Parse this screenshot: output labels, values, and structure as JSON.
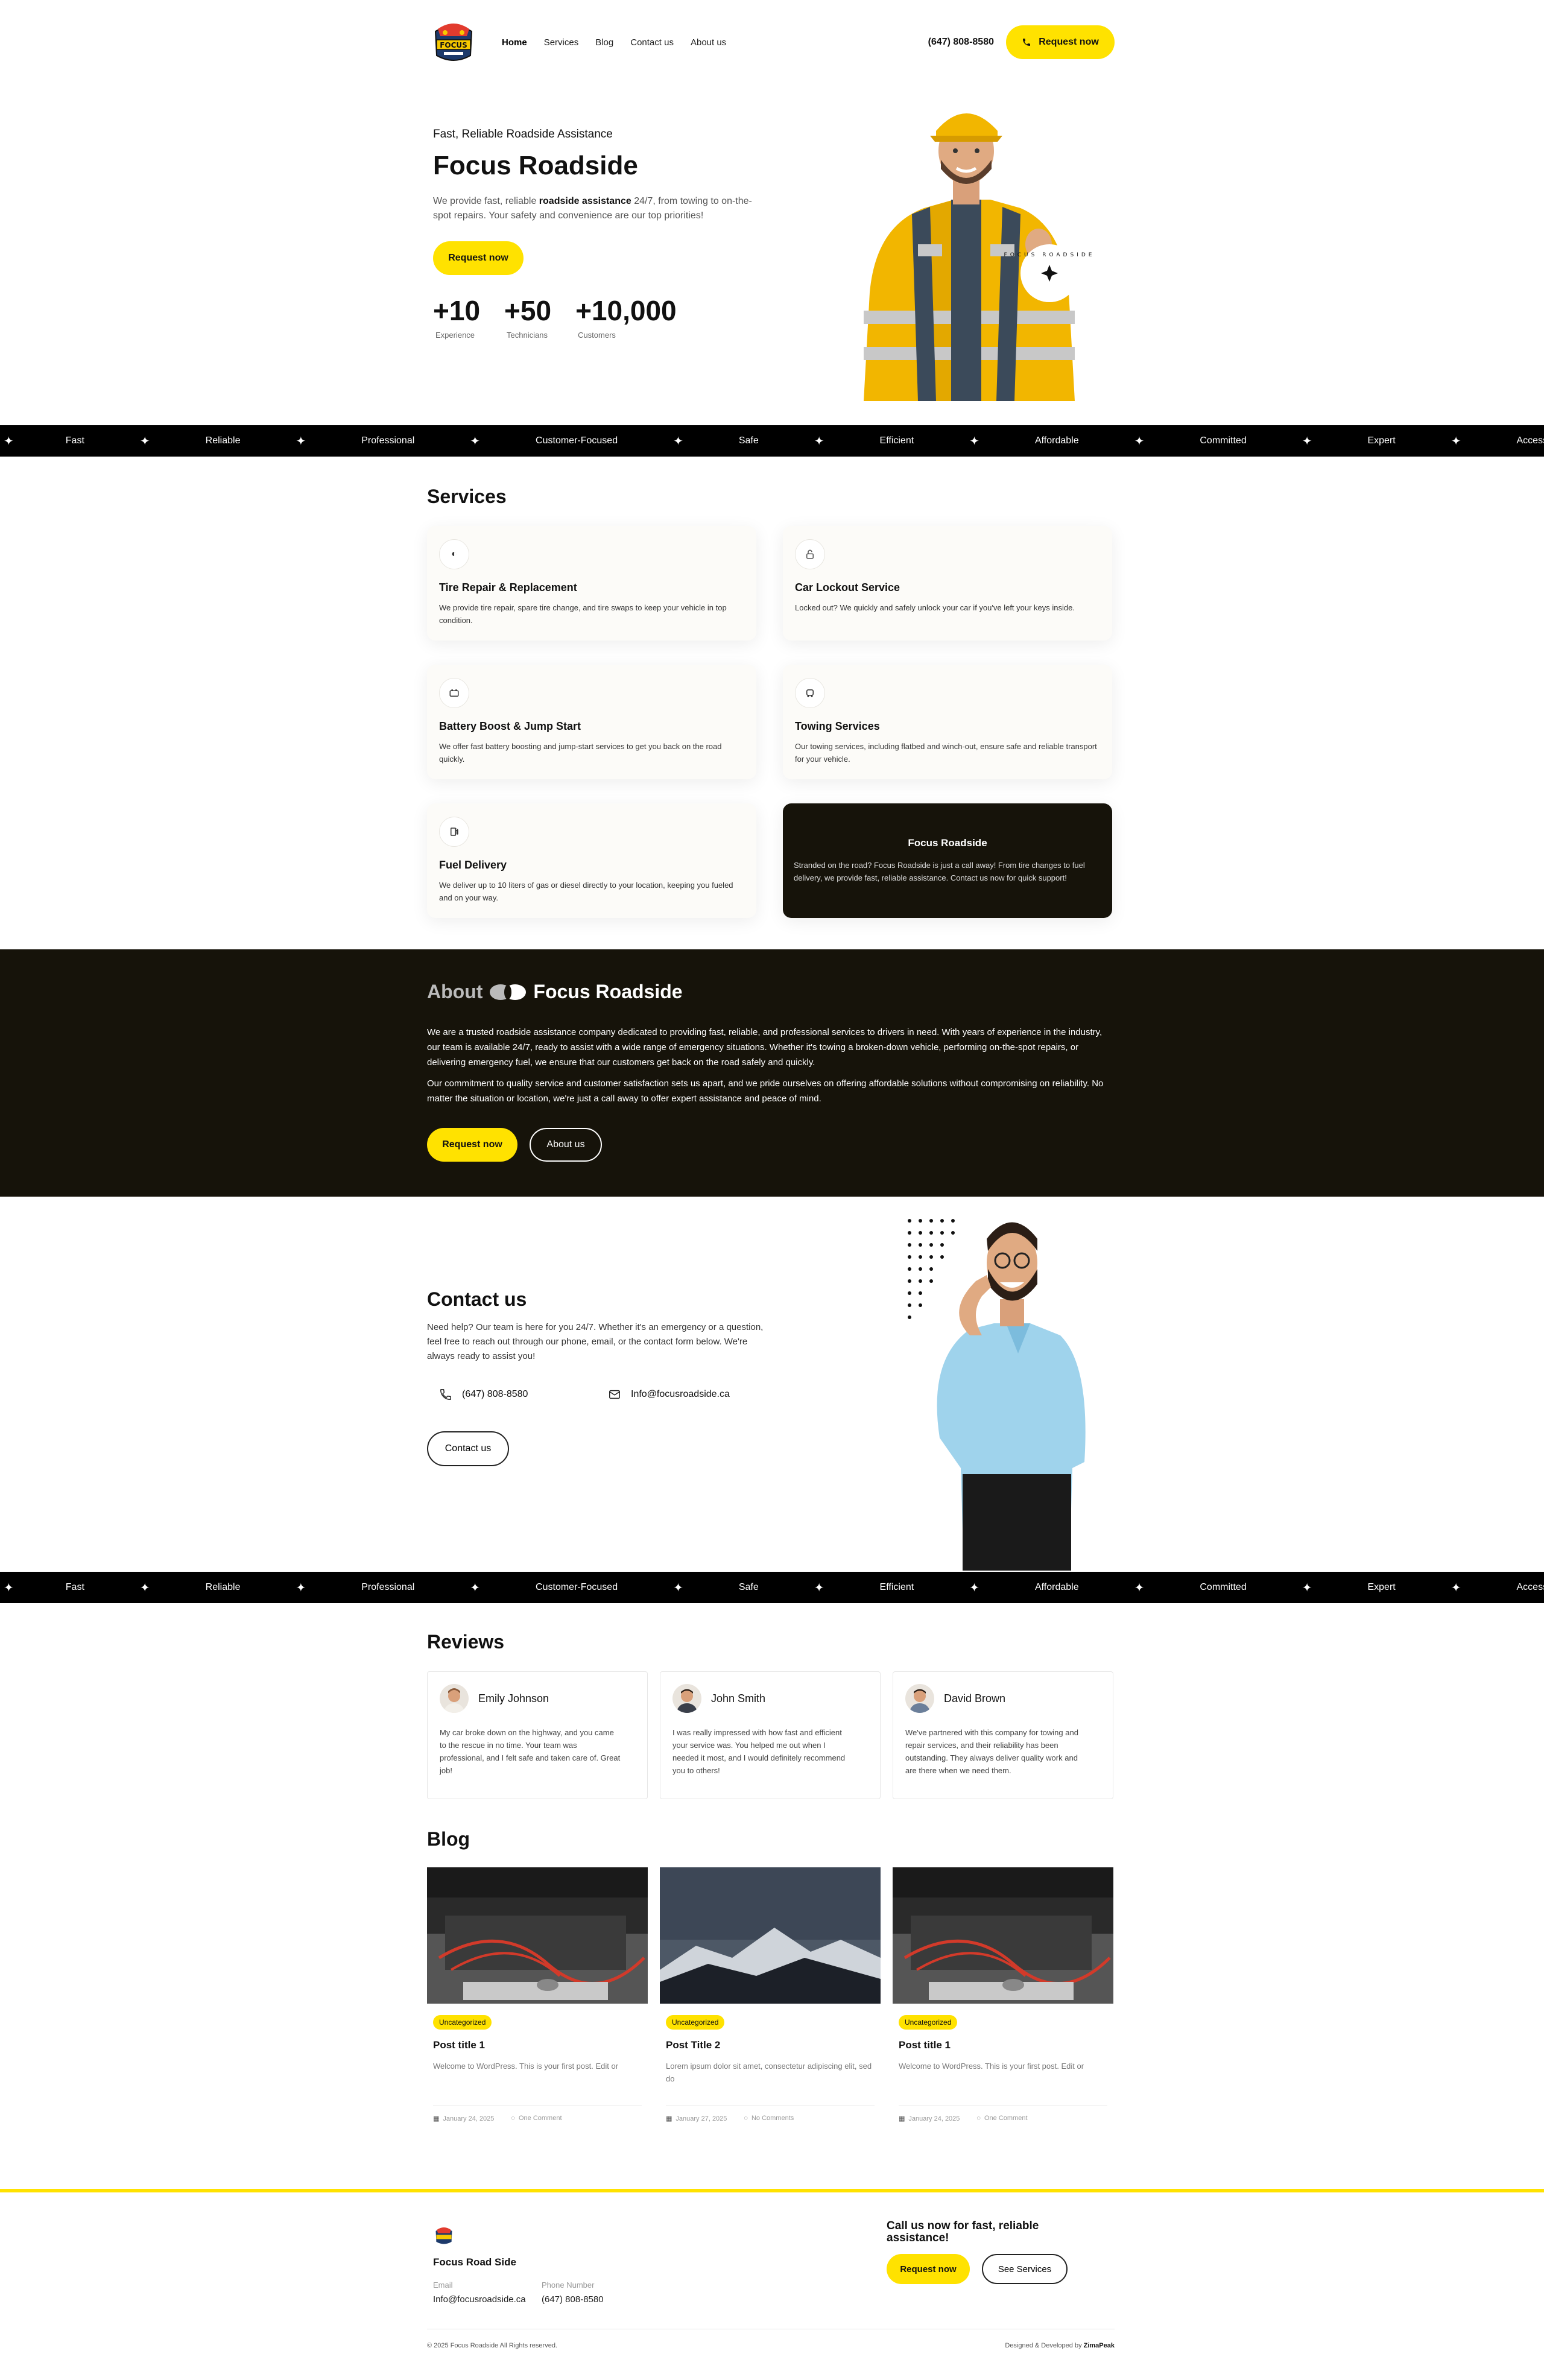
{
  "header": {
    "nav": [
      "Home",
      "Services",
      "Blog",
      "Contact us",
      "About us"
    ],
    "phone": "(647) 808-8580",
    "cta": "Request now"
  },
  "hero": {
    "tagline": "Fast, Reliable Roadside Assistance",
    "title": "Focus Roadside",
    "desc_before": "We provide fast, reliable ",
    "desc_bold": "roadside assistance",
    "desc_after": " 24/7, from towing to on-the-spot repairs. Your safety and convenience are our top priorities!",
    "cta": "Request now",
    "stats": [
      {
        "value": "+10",
        "label": "Experience"
      },
      {
        "value": "+50",
        "label": "Technicians"
      },
      {
        "value": "+10,000",
        "label": "Customers"
      }
    ],
    "badge_text": "FOCUS ROADSIDE"
  },
  "ticker": [
    "Fast",
    "Reliable",
    "Professional",
    "Customer-Focused",
    "Safe",
    "Efficient",
    "Affordable",
    "Committed",
    "Expert",
    "Accessible"
  ],
  "services": {
    "title": "Services",
    "items": [
      {
        "name": "Tire Repair & Replacement",
        "desc": "We provide tire repair, spare tire change, and tire swaps to keep your vehicle in top condition.",
        "icon": "tire-icon"
      },
      {
        "name": "Car Lockout Service",
        "desc": "Locked out? We quickly and safely unlock your car if you've left your keys inside.",
        "icon": "lock-icon"
      },
      {
        "name": "Battery Boost & Jump Start",
        "desc": "We offer fast battery boosting and jump-start services to get you back on the road quickly.",
        "icon": "battery-icon"
      },
      {
        "name": "Towing Services",
        "desc": "Our towing services, including flatbed and winch-out, ensure safe and reliable transport for your vehicle.",
        "icon": "truck-icon"
      },
      {
        "name": "Fuel Delivery",
        "desc": "We deliver up to 10 liters of gas or diesel directly to your location, keeping you fueled and on your way.",
        "icon": "fuel-icon"
      }
    ],
    "highlight": {
      "title": "Focus Roadside",
      "desc": "Stranded on the road? Focus Roadside is just a call away! From tire changes to fuel delivery, we provide fast, reliable assistance. Contact us now for quick support!"
    }
  },
  "about": {
    "title_prefix": "About",
    "title_main": "Focus Roadside",
    "p1": "We are a trusted roadside assistance company dedicated to providing fast, reliable, and professional services to drivers in need. With years of experience in the industry, our team is available 24/7, ready to assist with a wide range of emergency situations. Whether it's towing a broken-down vehicle, performing on-the-spot repairs, or delivering emergency fuel, we ensure that our customers get back on the road safely and quickly.",
    "p2": "Our commitment to quality service and customer satisfaction sets us apart, and we pride ourselves on offering affordable solutions without compromising on reliability. No matter the situation or location, we're just a call away to offer expert assistance and peace of mind.",
    "cta_primary": "Request now",
    "cta_secondary": "About us"
  },
  "contact": {
    "title": "Contact us",
    "desc": "Need help? Our team is here for you 24/7. Whether it's an emergency or a question, feel free to reach out through our phone, email, or the contact form below. We're always ready to assist you!",
    "phone": "(647) 808-8580",
    "email": "Info@focusroadside.ca",
    "cta": "Contact us"
  },
  "reviews": {
    "title": "Reviews",
    "items": [
      {
        "name": "Emily Johnson",
        "text": "My car broke down on the highway, and you came to the rescue in no time. Your team was professional, and I felt safe and taken care of. Great job!"
      },
      {
        "name": "John Smith",
        "text": "I was really impressed with how fast and efficient your service was. You helped me out when I needed it most, and I would definitely recommend you to others!"
      },
      {
        "name": "David Brown",
        "text": "We've partnered with this company for towing and repair services, and their reliability has been outstanding. They always deliver quality work and are there when we need them."
      }
    ]
  },
  "blog": {
    "title": "Blog",
    "posts": [
      {
        "category": "Uncategorized",
        "title": "Post title 1",
        "excerpt": "Welcome to WordPress. This is your first post. Edit or",
        "date": "January 24, 2025",
        "comments": "One Comment"
      },
      {
        "category": "Uncategorized",
        "title": "Post Title 2",
        "excerpt": "Lorem ipsum dolor sit amet, consectetur adipiscing elit, sed do",
        "date": "January 27, 2025",
        "comments": "No Comments"
      },
      {
        "category": "Uncategorized",
        "title": "Post title 1",
        "excerpt": "Welcome to WordPress. This is your first post. Edit or",
        "date": "January 24, 2025",
        "comments": "One Comment"
      }
    ]
  },
  "footer": {
    "brand": "Focus Road Side",
    "email_label": "Email",
    "email": "Info@focusroadside.ca",
    "phone_label": "Phone Number",
    "phone": "(647) 808-8580",
    "cta_title": "Call us now for fast, reliable assistance!",
    "cta_primary": "Request now",
    "cta_secondary": "See Services",
    "copyright": "© 2025 Focus Roadside All Rights reserved.",
    "credit_prefix": "Designed & Developed by ",
    "credit_name": "ZimaPeak"
  },
  "colors": {
    "accent": "#ffe200",
    "dark": "#16130a",
    "black": "#000000"
  }
}
